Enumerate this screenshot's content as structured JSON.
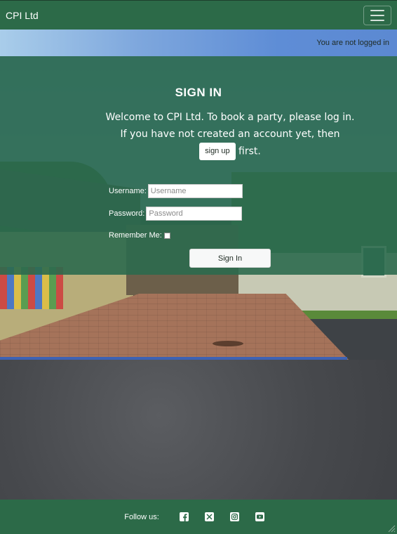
{
  "navbar": {
    "brand": "CPI Ltd",
    "toggler_icon": "hamburger-icon"
  },
  "status": {
    "login_text": "You are not logged in"
  },
  "signin": {
    "title": "SIGN IN",
    "welcome_before": "Welcome to CPI Ltd. To book a party, please log in. If you have not created an account yet, then ",
    "signup_label": "sign up",
    "welcome_after": " first.",
    "username_label": "Username:",
    "username_placeholder": "Username",
    "password_label": "Password:",
    "password_placeholder": "Password",
    "remember_label": "Remember Me:",
    "submit_label": "Sign In"
  },
  "footer": {
    "follow_label": "Follow us:",
    "social_icons": [
      "facebook-icon",
      "x-twitter-icon",
      "instagram-icon",
      "youtube-icon"
    ]
  },
  "colors": {
    "brand_green": "#2c6a48",
    "overlay_green": "#2c6a4e",
    "white": "#ffffff"
  }
}
